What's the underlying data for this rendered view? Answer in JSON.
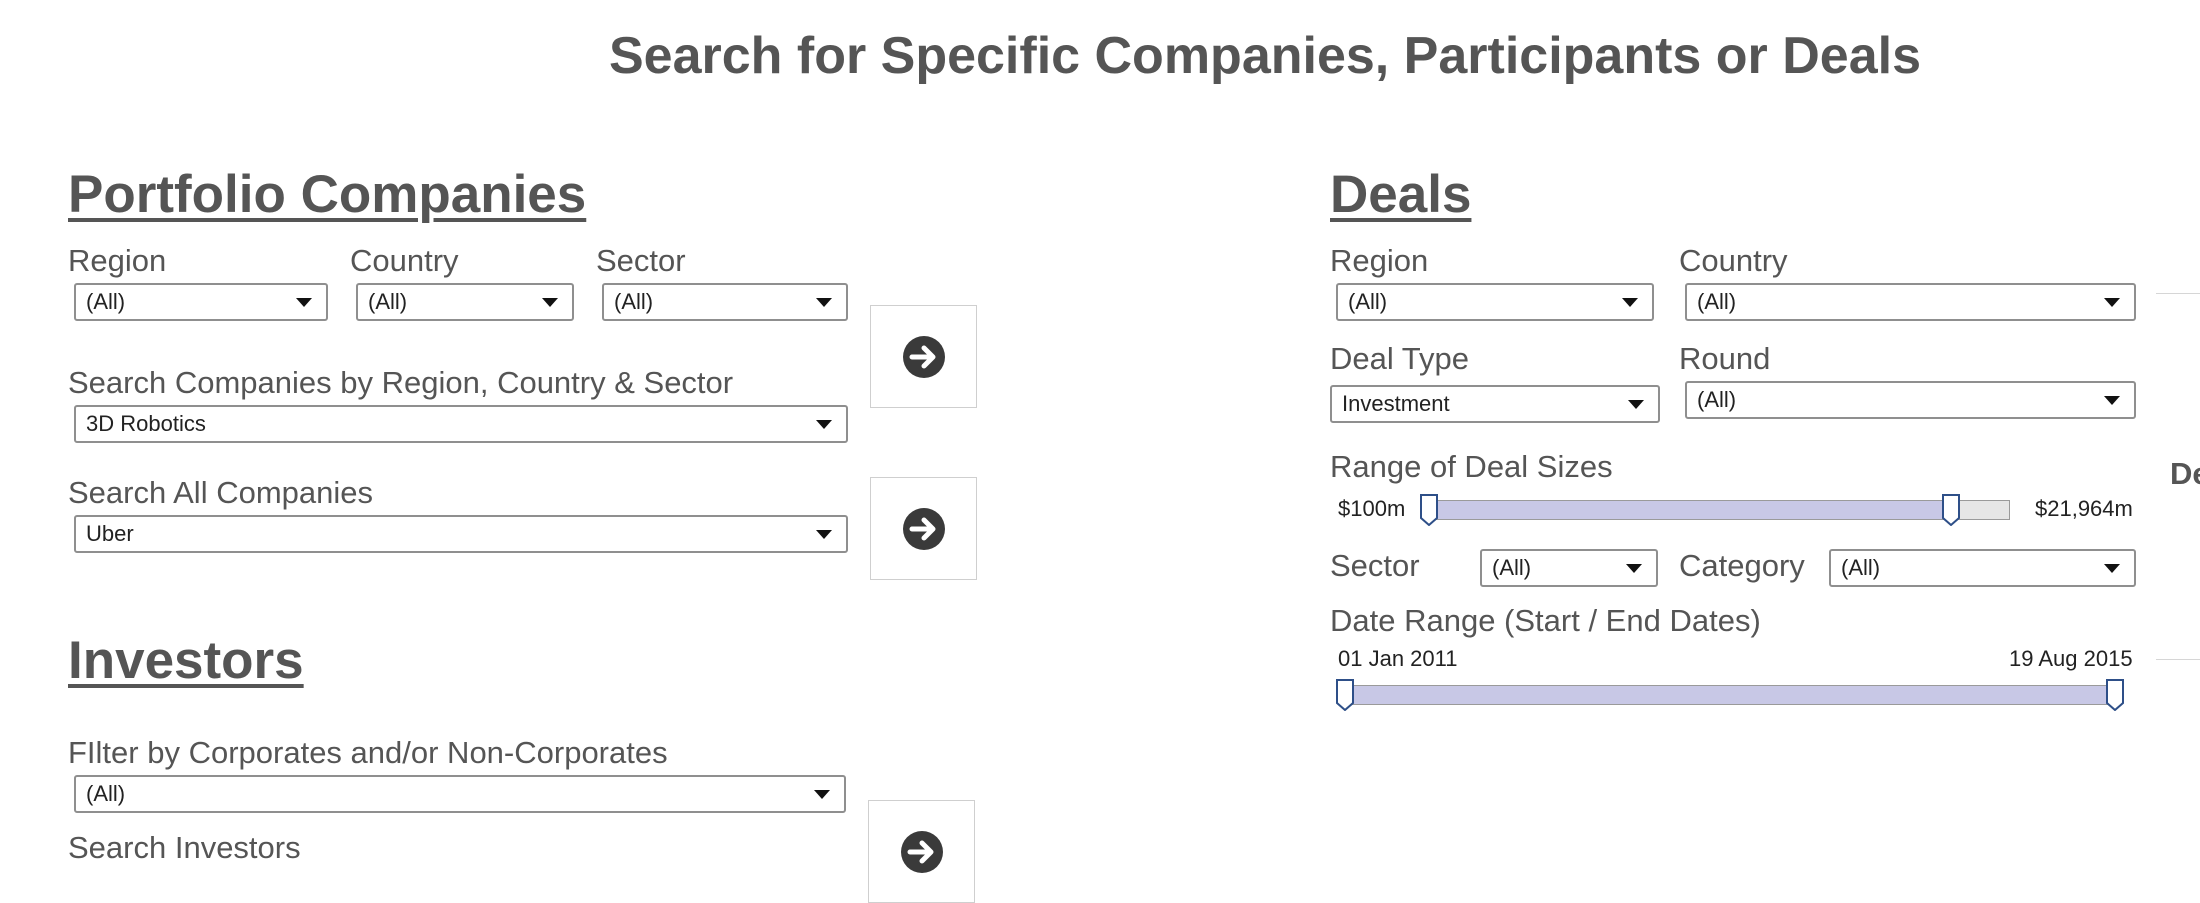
{
  "page_title": "Search for Specific Companies, Participants or Deals",
  "portfolio": {
    "title": "Portfolio Companies",
    "region": {
      "label": "Region",
      "value": "(All)"
    },
    "country": {
      "label": "Country",
      "value": "(All)"
    },
    "sector": {
      "label": "Sector",
      "value": "(All)"
    },
    "search_by": {
      "label": "Search Companies by Region, Country & Sector",
      "value": "3D Robotics"
    },
    "search_all": {
      "label": "Search All Companies",
      "value": "Uber"
    }
  },
  "investors": {
    "title": "Investors",
    "filter": {
      "label": "FIlter by Corporates and/or Non-Corporates",
      "value": "(All)"
    },
    "search_label": "Search Investors"
  },
  "deals": {
    "title": "Deals",
    "region": {
      "label": "Region",
      "value": "(All)"
    },
    "country": {
      "label": "Country",
      "value": "(All)"
    },
    "deal_type": {
      "label": "Deal Type",
      "value": "Investment"
    },
    "round": {
      "label": "Round",
      "value": "(All)"
    },
    "deal_sizes": {
      "label": "Range of Deal Sizes",
      "min_label": "$100m",
      "max_label": "$21,964m",
      "low_fraction": 0,
      "high_fraction": 0.9
    },
    "sector": {
      "label": "Sector",
      "value": "(All)"
    },
    "category": {
      "label": "Category",
      "value": "(All)"
    },
    "date_range": {
      "label": "Date Range (Start / End Dates)",
      "start": "01 Jan 2011",
      "end": "19 Aug 2015",
      "low_fraction": 0,
      "high_fraction": 1
    },
    "cutoff_text": "De"
  },
  "colors": {
    "text": "#555555",
    "slider_fill": "#c8c8e6",
    "handle": "#2e4f88",
    "arrow_icon": "#3a3a3a"
  },
  "icons": {
    "go": "arrow-circle-right-icon",
    "slider_handle": "slider-handle-icon"
  }
}
